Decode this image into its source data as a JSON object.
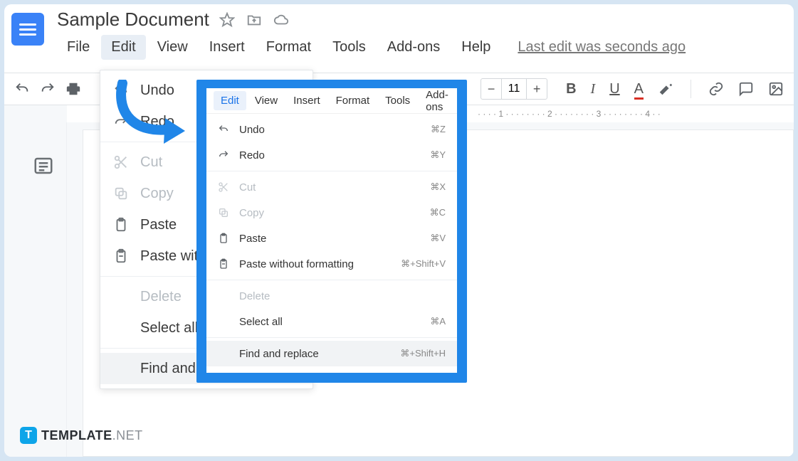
{
  "doc": {
    "title": "Sample Document"
  },
  "menus": {
    "file": "File",
    "edit": "Edit",
    "view": "View",
    "insert": "Insert",
    "format": "Format",
    "tools": "Tools",
    "addons": "Add-ons",
    "help": "Help",
    "last_edit": "Last edit was seconds ago"
  },
  "toolbar": {
    "font_size": "11"
  },
  "dropdown_main": {
    "undo": "Undo",
    "redo": "Redo",
    "cut": "Cut",
    "copy": "Copy",
    "paste": "Paste",
    "paste_without": "Paste wit",
    "delete": "Delete",
    "select_all": "Select all",
    "find_replace": "Find and"
  },
  "callout": {
    "menus": {
      "edit": "Edit",
      "view": "View",
      "insert": "Insert",
      "format": "Format",
      "tools": "Tools",
      "addons": "Add-ons"
    },
    "items": {
      "undo": {
        "label": "Undo",
        "shortcut": "⌘Z"
      },
      "redo": {
        "label": "Redo",
        "shortcut": "⌘Y"
      },
      "cut": {
        "label": "Cut",
        "shortcut": "⌘X"
      },
      "copy": {
        "label": "Copy",
        "shortcut": "⌘C"
      },
      "paste": {
        "label": "Paste",
        "shortcut": "⌘V"
      },
      "paste_wf": {
        "label": "Paste without formatting",
        "shortcut": "⌘+Shift+V"
      },
      "delete": {
        "label": "Delete",
        "shortcut": ""
      },
      "select_all": {
        "label": "Select all",
        "shortcut": "⌘A"
      },
      "find_replace": {
        "label": "Find and replace",
        "shortcut": "⌘+Shift+H"
      }
    }
  },
  "ruler": {
    "n1": "1",
    "n2": "2",
    "n3": "3",
    "n4": "4"
  },
  "watermark": {
    "brand": "TEMPLATE",
    "suffix": ".NET"
  },
  "colors": {
    "accent": "#2086e8"
  }
}
